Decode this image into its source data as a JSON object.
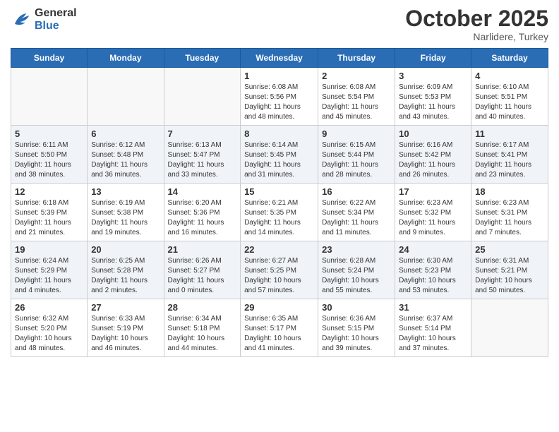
{
  "header": {
    "logo_line1": "General",
    "logo_line2": "Blue",
    "month": "October 2025",
    "location": "Narlidere, Turkey"
  },
  "weekdays": [
    "Sunday",
    "Monday",
    "Tuesday",
    "Wednesday",
    "Thursday",
    "Friday",
    "Saturday"
  ],
  "weeks": [
    [
      {
        "day": "",
        "info": ""
      },
      {
        "day": "",
        "info": ""
      },
      {
        "day": "",
        "info": ""
      },
      {
        "day": "1",
        "info": "Sunrise: 6:08 AM\nSunset: 5:56 PM\nDaylight: 11 hours and 48 minutes."
      },
      {
        "day": "2",
        "info": "Sunrise: 6:08 AM\nSunset: 5:54 PM\nDaylight: 11 hours and 45 minutes."
      },
      {
        "day": "3",
        "info": "Sunrise: 6:09 AM\nSunset: 5:53 PM\nDaylight: 11 hours and 43 minutes."
      },
      {
        "day": "4",
        "info": "Sunrise: 6:10 AM\nSunset: 5:51 PM\nDaylight: 11 hours and 40 minutes."
      }
    ],
    [
      {
        "day": "5",
        "info": "Sunrise: 6:11 AM\nSunset: 5:50 PM\nDaylight: 11 hours and 38 minutes."
      },
      {
        "day": "6",
        "info": "Sunrise: 6:12 AM\nSunset: 5:48 PM\nDaylight: 11 hours and 36 minutes."
      },
      {
        "day": "7",
        "info": "Sunrise: 6:13 AM\nSunset: 5:47 PM\nDaylight: 11 hours and 33 minutes."
      },
      {
        "day": "8",
        "info": "Sunrise: 6:14 AM\nSunset: 5:45 PM\nDaylight: 11 hours and 31 minutes."
      },
      {
        "day": "9",
        "info": "Sunrise: 6:15 AM\nSunset: 5:44 PM\nDaylight: 11 hours and 28 minutes."
      },
      {
        "day": "10",
        "info": "Sunrise: 6:16 AM\nSunset: 5:42 PM\nDaylight: 11 hours and 26 minutes."
      },
      {
        "day": "11",
        "info": "Sunrise: 6:17 AM\nSunset: 5:41 PM\nDaylight: 11 hours and 23 minutes."
      }
    ],
    [
      {
        "day": "12",
        "info": "Sunrise: 6:18 AM\nSunset: 5:39 PM\nDaylight: 11 hours and 21 minutes."
      },
      {
        "day": "13",
        "info": "Sunrise: 6:19 AM\nSunset: 5:38 PM\nDaylight: 11 hours and 19 minutes."
      },
      {
        "day": "14",
        "info": "Sunrise: 6:20 AM\nSunset: 5:36 PM\nDaylight: 11 hours and 16 minutes."
      },
      {
        "day": "15",
        "info": "Sunrise: 6:21 AM\nSunset: 5:35 PM\nDaylight: 11 hours and 14 minutes."
      },
      {
        "day": "16",
        "info": "Sunrise: 6:22 AM\nSunset: 5:34 PM\nDaylight: 11 hours and 11 minutes."
      },
      {
        "day": "17",
        "info": "Sunrise: 6:23 AM\nSunset: 5:32 PM\nDaylight: 11 hours and 9 minutes."
      },
      {
        "day": "18",
        "info": "Sunrise: 6:23 AM\nSunset: 5:31 PM\nDaylight: 11 hours and 7 minutes."
      }
    ],
    [
      {
        "day": "19",
        "info": "Sunrise: 6:24 AM\nSunset: 5:29 PM\nDaylight: 11 hours and 4 minutes."
      },
      {
        "day": "20",
        "info": "Sunrise: 6:25 AM\nSunset: 5:28 PM\nDaylight: 11 hours and 2 minutes."
      },
      {
        "day": "21",
        "info": "Sunrise: 6:26 AM\nSunset: 5:27 PM\nDaylight: 11 hours and 0 minutes."
      },
      {
        "day": "22",
        "info": "Sunrise: 6:27 AM\nSunset: 5:25 PM\nDaylight: 10 hours and 57 minutes."
      },
      {
        "day": "23",
        "info": "Sunrise: 6:28 AM\nSunset: 5:24 PM\nDaylight: 10 hours and 55 minutes."
      },
      {
        "day": "24",
        "info": "Sunrise: 6:30 AM\nSunset: 5:23 PM\nDaylight: 10 hours and 53 minutes."
      },
      {
        "day": "25",
        "info": "Sunrise: 6:31 AM\nSunset: 5:21 PM\nDaylight: 10 hours and 50 minutes."
      }
    ],
    [
      {
        "day": "26",
        "info": "Sunrise: 6:32 AM\nSunset: 5:20 PM\nDaylight: 10 hours and 48 minutes."
      },
      {
        "day": "27",
        "info": "Sunrise: 6:33 AM\nSunset: 5:19 PM\nDaylight: 10 hours and 46 minutes."
      },
      {
        "day": "28",
        "info": "Sunrise: 6:34 AM\nSunset: 5:18 PM\nDaylight: 10 hours and 44 minutes."
      },
      {
        "day": "29",
        "info": "Sunrise: 6:35 AM\nSunset: 5:17 PM\nDaylight: 10 hours and 41 minutes."
      },
      {
        "day": "30",
        "info": "Sunrise: 6:36 AM\nSunset: 5:15 PM\nDaylight: 10 hours and 39 minutes."
      },
      {
        "day": "31",
        "info": "Sunrise: 6:37 AM\nSunset: 5:14 PM\nDaylight: 10 hours and 37 minutes."
      },
      {
        "day": "",
        "info": ""
      }
    ]
  ]
}
